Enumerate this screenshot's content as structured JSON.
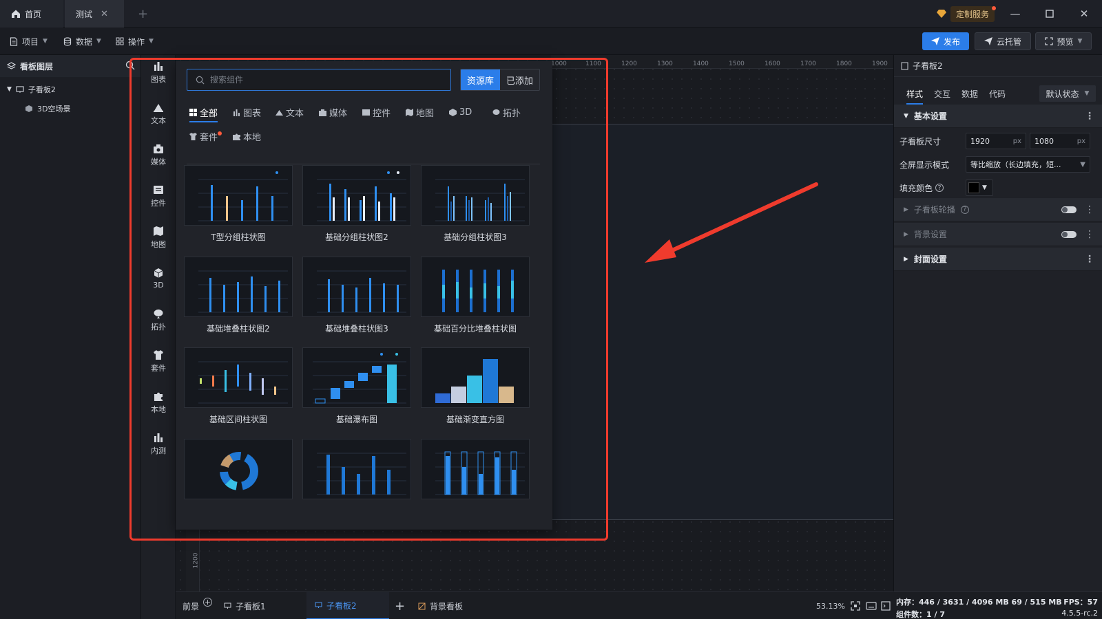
{
  "tabs": {
    "home": "首页",
    "test": "测试"
  },
  "window": {
    "custom_service": "定制服务"
  },
  "toolbar": {
    "project": "项目",
    "data": "数据",
    "operation": "操作",
    "publish": "发布",
    "cloud": "云托管",
    "preview": "预览"
  },
  "layers": {
    "title": "看板图层",
    "items": [
      {
        "label": "子看板2"
      },
      {
        "label": "3D空场景"
      }
    ]
  },
  "rail": [
    "图表",
    "文本",
    "媒体",
    "控件",
    "地图",
    "3D",
    "拓扑",
    "套件",
    "本地",
    "内测"
  ],
  "panel": {
    "search_placeholder": "搜索组件",
    "seg_library": "资源库",
    "seg_added": "已添加",
    "tabs": [
      "全部",
      "图表",
      "文本",
      "媒体",
      "控件",
      "地图",
      "3D",
      "拓扑",
      "套件",
      "本地"
    ],
    "cards": [
      {
        "label": "T型分组柱状图"
      },
      {
        "label": "基础分组柱状图2"
      },
      {
        "label": "基础分组柱状图3"
      },
      {
        "label": "基础堆叠柱状图2"
      },
      {
        "label": "基础堆叠柱状图3"
      },
      {
        "label": "基础百分比堆叠柱状图"
      },
      {
        "label": "基础区间柱状图"
      },
      {
        "label": "基础瀑布图"
      },
      {
        "label": "基础渐变直方图"
      }
    ]
  },
  "ruler": {
    "marks": [
      "1000",
      "1100",
      "1200",
      "1300",
      "1400",
      "1500",
      "1600",
      "1700",
      "1800",
      "1900"
    ],
    "left_mark": "1200"
  },
  "right": {
    "title": "子看板2",
    "tabs": [
      "样式",
      "交互",
      "数据",
      "代码"
    ],
    "state": "默认状态",
    "sections": {
      "basic": "基本设置",
      "carousel": "子看板轮播",
      "background": "背景设置",
      "cover": "封面设置"
    },
    "size_label": "子看板尺寸",
    "width": "1920",
    "height": "1080",
    "unit": "px",
    "fullscreen_label": "全屏显示模式",
    "fullscreen_value": "等比缩放（长边填充，短...",
    "fill_label": "填充颜色",
    "fill_color": "#000000"
  },
  "bottom": {
    "foreground": "前景",
    "sub1": "子看板1",
    "sub2": "子看板2",
    "bg": "背景看板",
    "zoom": "53.13%"
  },
  "status": {
    "memory": "内存：446 / 3631 / 4096 MB  69 / 515 MB",
    "fps": "FPS：57",
    "count": "组件数：1 / 7",
    "version": "4.5.5-rc.2"
  },
  "colors": {
    "accent": "#2b7de9",
    "annotation": "#ef3b2d"
  }
}
